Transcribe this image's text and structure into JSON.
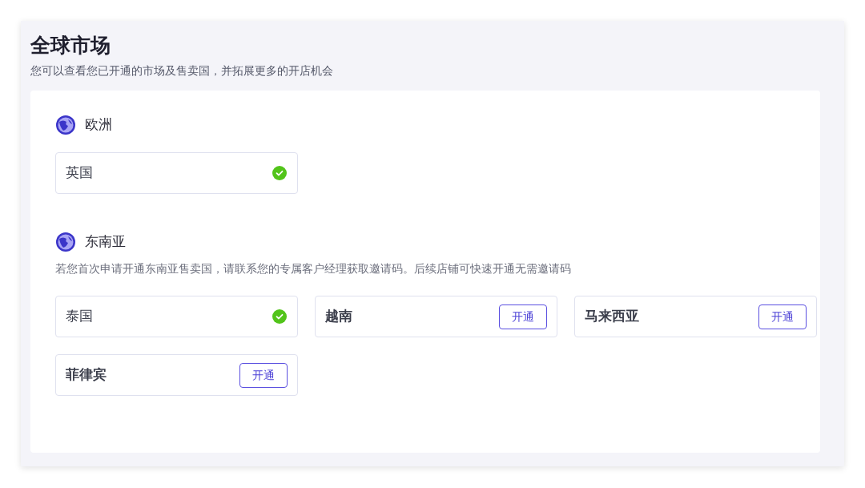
{
  "header": {
    "title": "全球市场",
    "subtitle": "您可以查看您已开通的市场及售卖国，并拓展更多的开店机会"
  },
  "regions": [
    {
      "name": "欧洲",
      "countries": [
        {
          "name": "英国",
          "opened": true
        }
      ]
    },
    {
      "name": "东南亚",
      "note": "若您首次申请开通东南亚售卖国，请联系您的专属客户经理获取邀请码。后续店铺可快速开通无需邀请码",
      "countries": [
        {
          "name": "泰国",
          "opened": true
        },
        {
          "name": "越南",
          "opened": false,
          "action": "开通"
        },
        {
          "name": "马来西亚",
          "opened": false,
          "action": "开通"
        },
        {
          "name": "菲律宾",
          "opened": false,
          "action": "开通"
        }
      ]
    }
  ]
}
